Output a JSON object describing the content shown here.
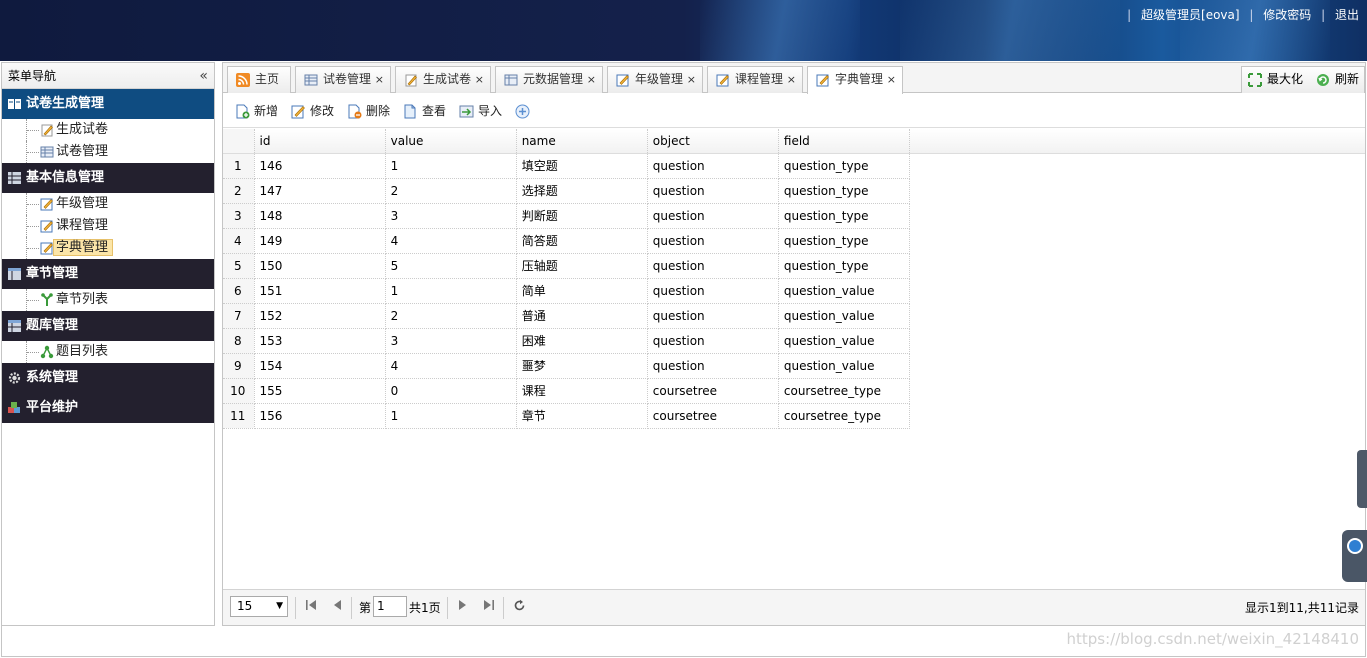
{
  "header": {
    "user_link": "超级管理员[eova]",
    "change_password": "修改密码",
    "logout": "退出",
    "separator": "|"
  },
  "sidebar": {
    "title": "菜单导航",
    "collapse_icon": "«",
    "groups": [
      {
        "label": "试卷生成管理",
        "icon": "book-icon",
        "items": [
          {
            "label": "生成试卷",
            "icon": "pencil-icon"
          },
          {
            "label": "试卷管理",
            "icon": "table-icon"
          }
        ]
      },
      {
        "label": "基本信息管理",
        "icon": "grid-icon",
        "items": [
          {
            "label": "年级管理",
            "icon": "edit-icon"
          },
          {
            "label": "课程管理",
            "icon": "edit-icon"
          },
          {
            "label": "字典管理",
            "icon": "edit-icon"
          }
        ]
      },
      {
        "label": "章节管理",
        "icon": "table-icon",
        "items": [
          {
            "label": "章节列表",
            "icon": "branch-icon"
          }
        ]
      },
      {
        "label": "题库管理",
        "icon": "table-icon",
        "items": [
          {
            "label": "题目列表",
            "icon": "tree-icon"
          }
        ]
      },
      {
        "label": "系统管理",
        "icon": "gear-icon",
        "items": []
      },
      {
        "label": "平台维护",
        "icon": "cubes-icon",
        "items": []
      }
    ]
  },
  "tabs": [
    {
      "label": "主页",
      "icon": "rss-icon",
      "closable": false
    },
    {
      "label": "试卷管理",
      "icon": "table-icon",
      "closable": true
    },
    {
      "label": "生成试卷",
      "icon": "pencil-icon",
      "closable": true
    },
    {
      "label": "元数据管理",
      "icon": "table-icon",
      "closable": true
    },
    {
      "label": "年级管理",
      "icon": "edit-icon",
      "closable": true
    },
    {
      "label": "课程管理",
      "icon": "edit-icon",
      "closable": true
    },
    {
      "label": "字典管理",
      "icon": "edit-icon",
      "closable": true,
      "active": true
    }
  ],
  "tab_close_glyph": "×",
  "tab_tools": {
    "maximize": "最大化",
    "refresh": "刷新"
  },
  "toolbar": {
    "add": "新增",
    "edit": "修改",
    "delete": "删除",
    "view": "查看",
    "import": "导入"
  },
  "grid": {
    "columns": [
      "id",
      "value",
      "name",
      "object",
      "field"
    ],
    "rows": [
      [
        "1",
        "146",
        "1",
        "填空题",
        "question",
        "question_type"
      ],
      [
        "2",
        "147",
        "2",
        "选择题",
        "question",
        "question_type"
      ],
      [
        "3",
        "148",
        "3",
        "判断题",
        "question",
        "question_type"
      ],
      [
        "4",
        "149",
        "4",
        "简答题",
        "question",
        "question_type"
      ],
      [
        "5",
        "150",
        "5",
        "压轴题",
        "question",
        "question_type"
      ],
      [
        "6",
        "151",
        "1",
        "简单",
        "question",
        "question_value"
      ],
      [
        "7",
        "152",
        "2",
        "普通",
        "question",
        "question_value"
      ],
      [
        "8",
        "153",
        "3",
        "困难",
        "question",
        "question_value"
      ],
      [
        "9",
        "154",
        "4",
        "噩梦",
        "question",
        "question_value"
      ],
      [
        "10",
        "155",
        "0",
        "课程",
        "coursetree",
        "coursetree_type"
      ],
      [
        "11",
        "156",
        "1",
        "章节",
        "coursetree",
        "coursetree_type"
      ]
    ]
  },
  "pager": {
    "page_size": "15",
    "page_prefix": "第",
    "page_value": "1",
    "page_total": "共1页",
    "info": "显示1到11,共11记录"
  },
  "watermark": "https://blog.csdn.net/weixin_42148410",
  "colors": {
    "header_bg": "#14214b",
    "active_group": "#0f4c81",
    "dark_group": "#23202e",
    "selected_item": "#fbe5a8"
  }
}
